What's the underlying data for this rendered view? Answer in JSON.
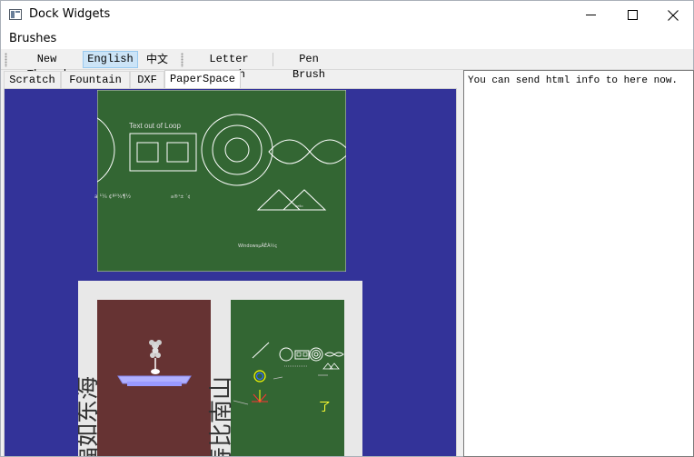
{
  "window": {
    "title": "Dock Widgets",
    "controls": {
      "minimize_icon": "minimize-icon",
      "maximize_icon": "maximize-icon",
      "close_icon": "close-icon"
    }
  },
  "menubar": {
    "items": [
      {
        "label": "Brushes"
      }
    ]
  },
  "toolbar": {
    "buttons": [
      {
        "label": "New Thread",
        "checked": false
      },
      {
        "label": "English",
        "checked": true
      },
      {
        "label": "中文",
        "checked": false
      },
      {
        "label": "Letter Brush",
        "checked": false
      },
      {
        "label": "Pen Brush",
        "checked": false
      }
    ]
  },
  "tabs": [
    {
      "label": "Scratch",
      "active": false
    },
    {
      "label": "Fountain",
      "active": false
    },
    {
      "label": "DXF",
      "active": false
    },
    {
      "label": "PaperSpace",
      "active": true
    }
  ],
  "canvas": {
    "background_color": "#333399",
    "board_color": "#336633",
    "panel_color": "#663333",
    "sheet_color": "#e8e8e8",
    "board_top_text": "Text out of Loop",
    "board_top_garbled_1": "a ¹¼ ¢ª²¾¶½",
    "board_top_garbled_2": "a®¹± ´¢",
    "board_top_footer": "WindowsµÄÊÀ½ç",
    "triangle_label": "hello",
    "vertical_text_left": "福如东海",
    "vertical_text_right": "寿比南山",
    "small_yellow_glyph": "了"
  },
  "info_panel": {
    "text": "You can send html info to here now."
  }
}
